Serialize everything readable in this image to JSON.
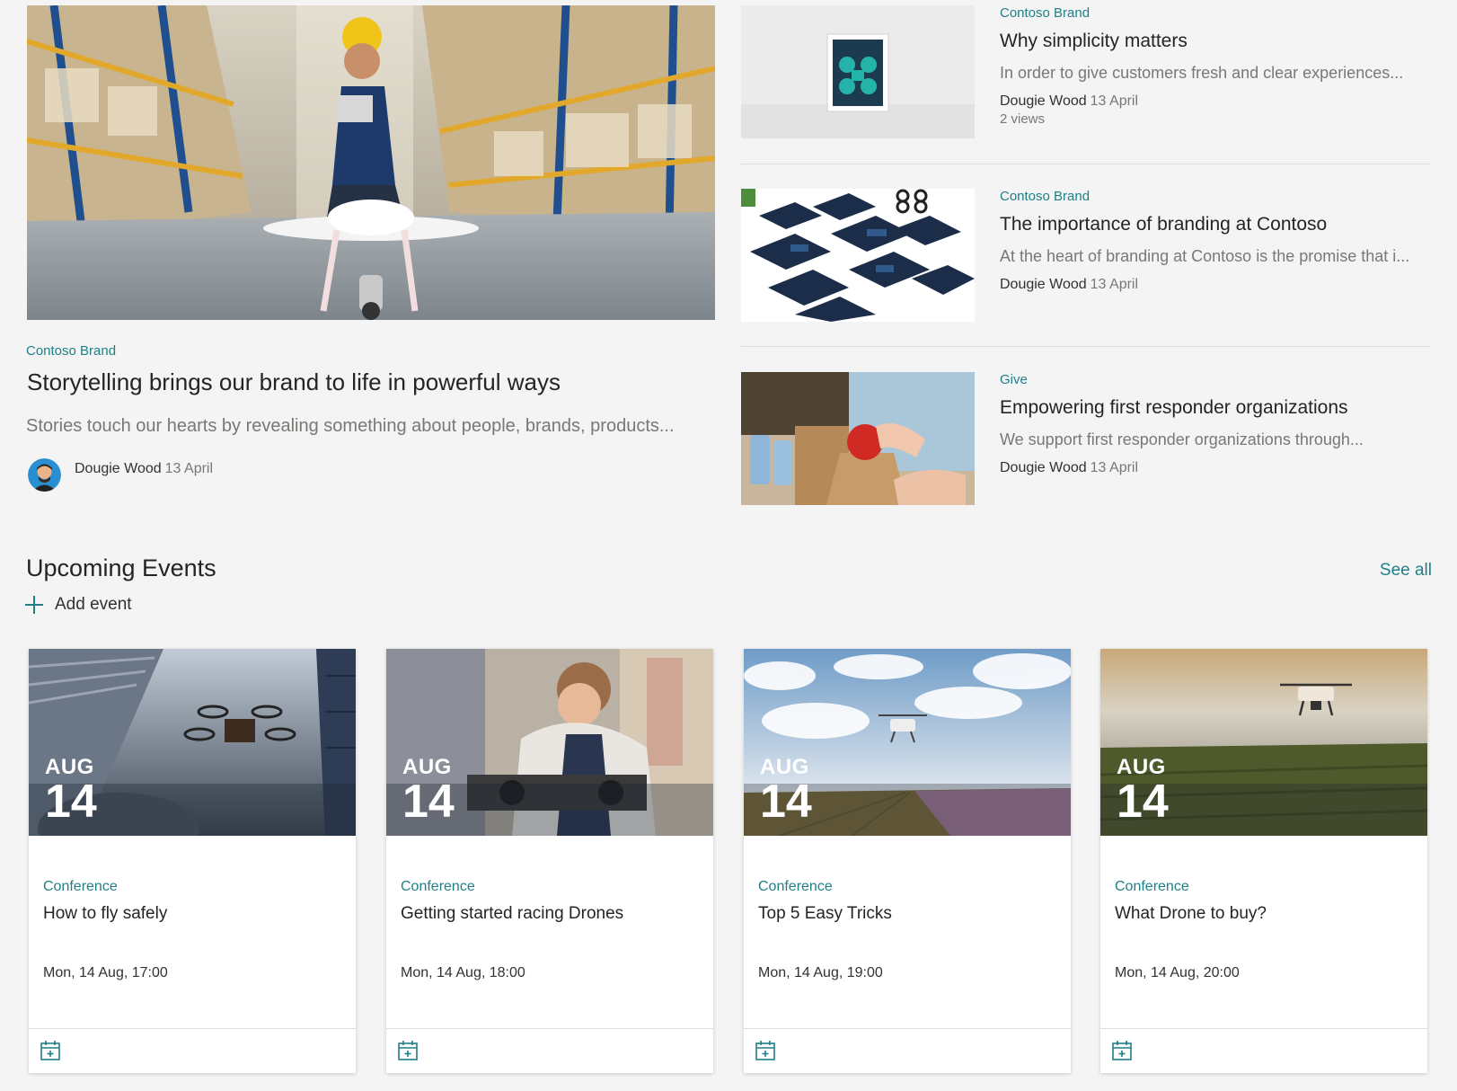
{
  "hero": {
    "category": "Contoso Brand",
    "title": "Storytelling brings our brand to life in powerful ways",
    "description": "Stories touch our hearts by revealing something about people, brands, products...",
    "author": "Dougie Wood",
    "date": "13 April",
    "image_icon": "drone-warehouse-photo"
  },
  "news": [
    {
      "category": "Contoso Brand",
      "title": "Why simplicity matters",
      "description": "In order to give customers fresh and clear experiences...",
      "author": "Dougie Wood",
      "date": "13 April",
      "views": "2 views",
      "image_icon": "framed-logo-photo"
    },
    {
      "category": "Contoso Brand",
      "title": "The importance of branding at Contoso",
      "description": "At the heart of branding at Contoso is the promise that i...",
      "author": "Dougie Wood",
      "date": "13 April",
      "image_icon": "brand-devices-photo"
    },
    {
      "category": "Give",
      "title": "Empowering first responder organizations",
      "description": "We support first responder organizations through...",
      "author": "Dougie Wood",
      "date": "13 April",
      "image_icon": "food-donation-photo"
    }
  ],
  "events": {
    "title": "Upcoming Events",
    "see_all": "See all",
    "add_event": "Add event",
    "cards": [
      {
        "month": "AUG",
        "day": "14",
        "category": "Conference",
        "title": "How to fly safely",
        "time": "Mon, 14 Aug, 17:00",
        "image_icon": "drone-skyscraper-photo"
      },
      {
        "month": "AUG",
        "day": "14",
        "category": "Conference",
        "title": "Getting started racing Drones",
        "time": "Mon, 14 Aug, 18:00",
        "image_icon": "drone-workshop-photo"
      },
      {
        "month": "AUG",
        "day": "14",
        "category": "Conference",
        "title": "Top 5 Easy Tricks",
        "time": "Mon, 14 Aug, 19:00",
        "image_icon": "drone-tulip-field-photo"
      },
      {
        "month": "AUG",
        "day": "14",
        "category": "Conference",
        "title": "What Drone to buy?",
        "time": "Mon, 14 Aug, 20:00",
        "image_icon": "drone-crop-field-photo"
      }
    ]
  },
  "colors": {
    "accent": "#1f7f86",
    "background": "#f4f4f4",
    "text": "#323130",
    "muted": "#7a7775"
  }
}
